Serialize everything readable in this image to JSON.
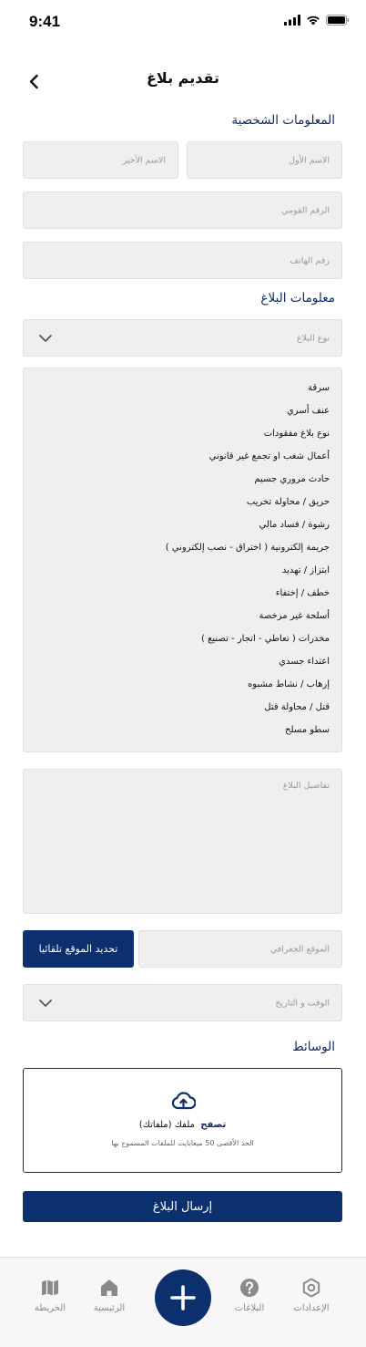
{
  "status_bar": {
    "time": "9:41"
  },
  "header": {
    "title": "تقديم بلاغ"
  },
  "personal_section": {
    "title": "المعلومات الشخصية",
    "first_name_placeholder": "الاسم الأول",
    "last_name_placeholder": "الاسم الأخير",
    "national_id_placeholder": "الرقم القومي",
    "phone_placeholder": "رقم الهاتف"
  },
  "report_section": {
    "title": "معلومات البلاغ",
    "report_type_placeholder": "نوع البلاغ",
    "report_types": [
      "سرقة",
      "عنف أسري",
      "نوع بلاغ مفقودات",
      "أعمال شغب او تجمع غير قانوني",
      "حادث مروري جسيم",
      "حريق / محاولة تخريب",
      "رشوة / فساد مالي",
      "جريمة إلكترونية ( اختراق - نصب إلكتروني )",
      "ابتزاز / تهديد",
      "خطف / إختفاء",
      "أسلحة غير مرخصة",
      "مخدرات ( تعاطي - اتجار - تصنيع )",
      "اعتداء جسدي",
      "إرهاب / نشاط مشبوه",
      "قتل / محاولة قتل",
      "سطو مسلح"
    ],
    "details_placeholder": "تفاصيل البلاغ",
    "location_placeholder": "الموقع الجغرافي",
    "auto_location_label": "تحديد الموقع تلقائيا",
    "datetime_placeholder": "الوقت و التاريخ"
  },
  "media_section": {
    "title": "الوسائط",
    "browse_label": "تصفح",
    "files_label": "ملفك (ملفاتك)",
    "limit_text": "الحد الأقصى 50 ميغابايت للملفات المسموح بها"
  },
  "submit_label": "إرسال البلاغ",
  "tabbar": {
    "settings": "الإعدادات",
    "reports": "البلاغات",
    "home": "الرئيسية",
    "map": "الخريطة"
  },
  "colors": {
    "primary": "#0c2f6e",
    "field_bg": "#efefef",
    "placeholder": "#9a9a9a",
    "section_title": "#0b2a5e"
  }
}
